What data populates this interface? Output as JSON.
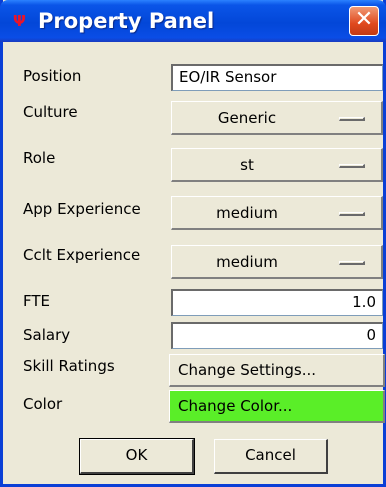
{
  "window": {
    "title": "Property Panel",
    "icon": "app-icon",
    "icon_glyph": "Ψ",
    "close_glyph": "✕"
  },
  "fields": {
    "position": {
      "label": "Position",
      "value": "EO/IR Sensor"
    },
    "culture": {
      "label": "Culture",
      "value": "Generic"
    },
    "role": {
      "label": "Role",
      "value": "st"
    },
    "app_experience": {
      "label": "App Experience",
      "value": "medium"
    },
    "cclt_experience": {
      "label": "Cclt Experience",
      "value": "medium"
    },
    "fte": {
      "label": "FTE",
      "value": "1.0"
    },
    "salary": {
      "label": "Salary",
      "value": "0"
    },
    "skill_ratings": {
      "label": "Skill Ratings",
      "button": "Change Settings..."
    },
    "color": {
      "label": "Color",
      "button": "Change Color...",
      "swatch": "#5aee28"
    }
  },
  "buttons": {
    "ok": "OK",
    "cancel": "Cancel"
  },
  "colors": {
    "titlebar": "#0347d8",
    "dialog_bg": "#ece9d8",
    "close_button": "#e0491e"
  }
}
